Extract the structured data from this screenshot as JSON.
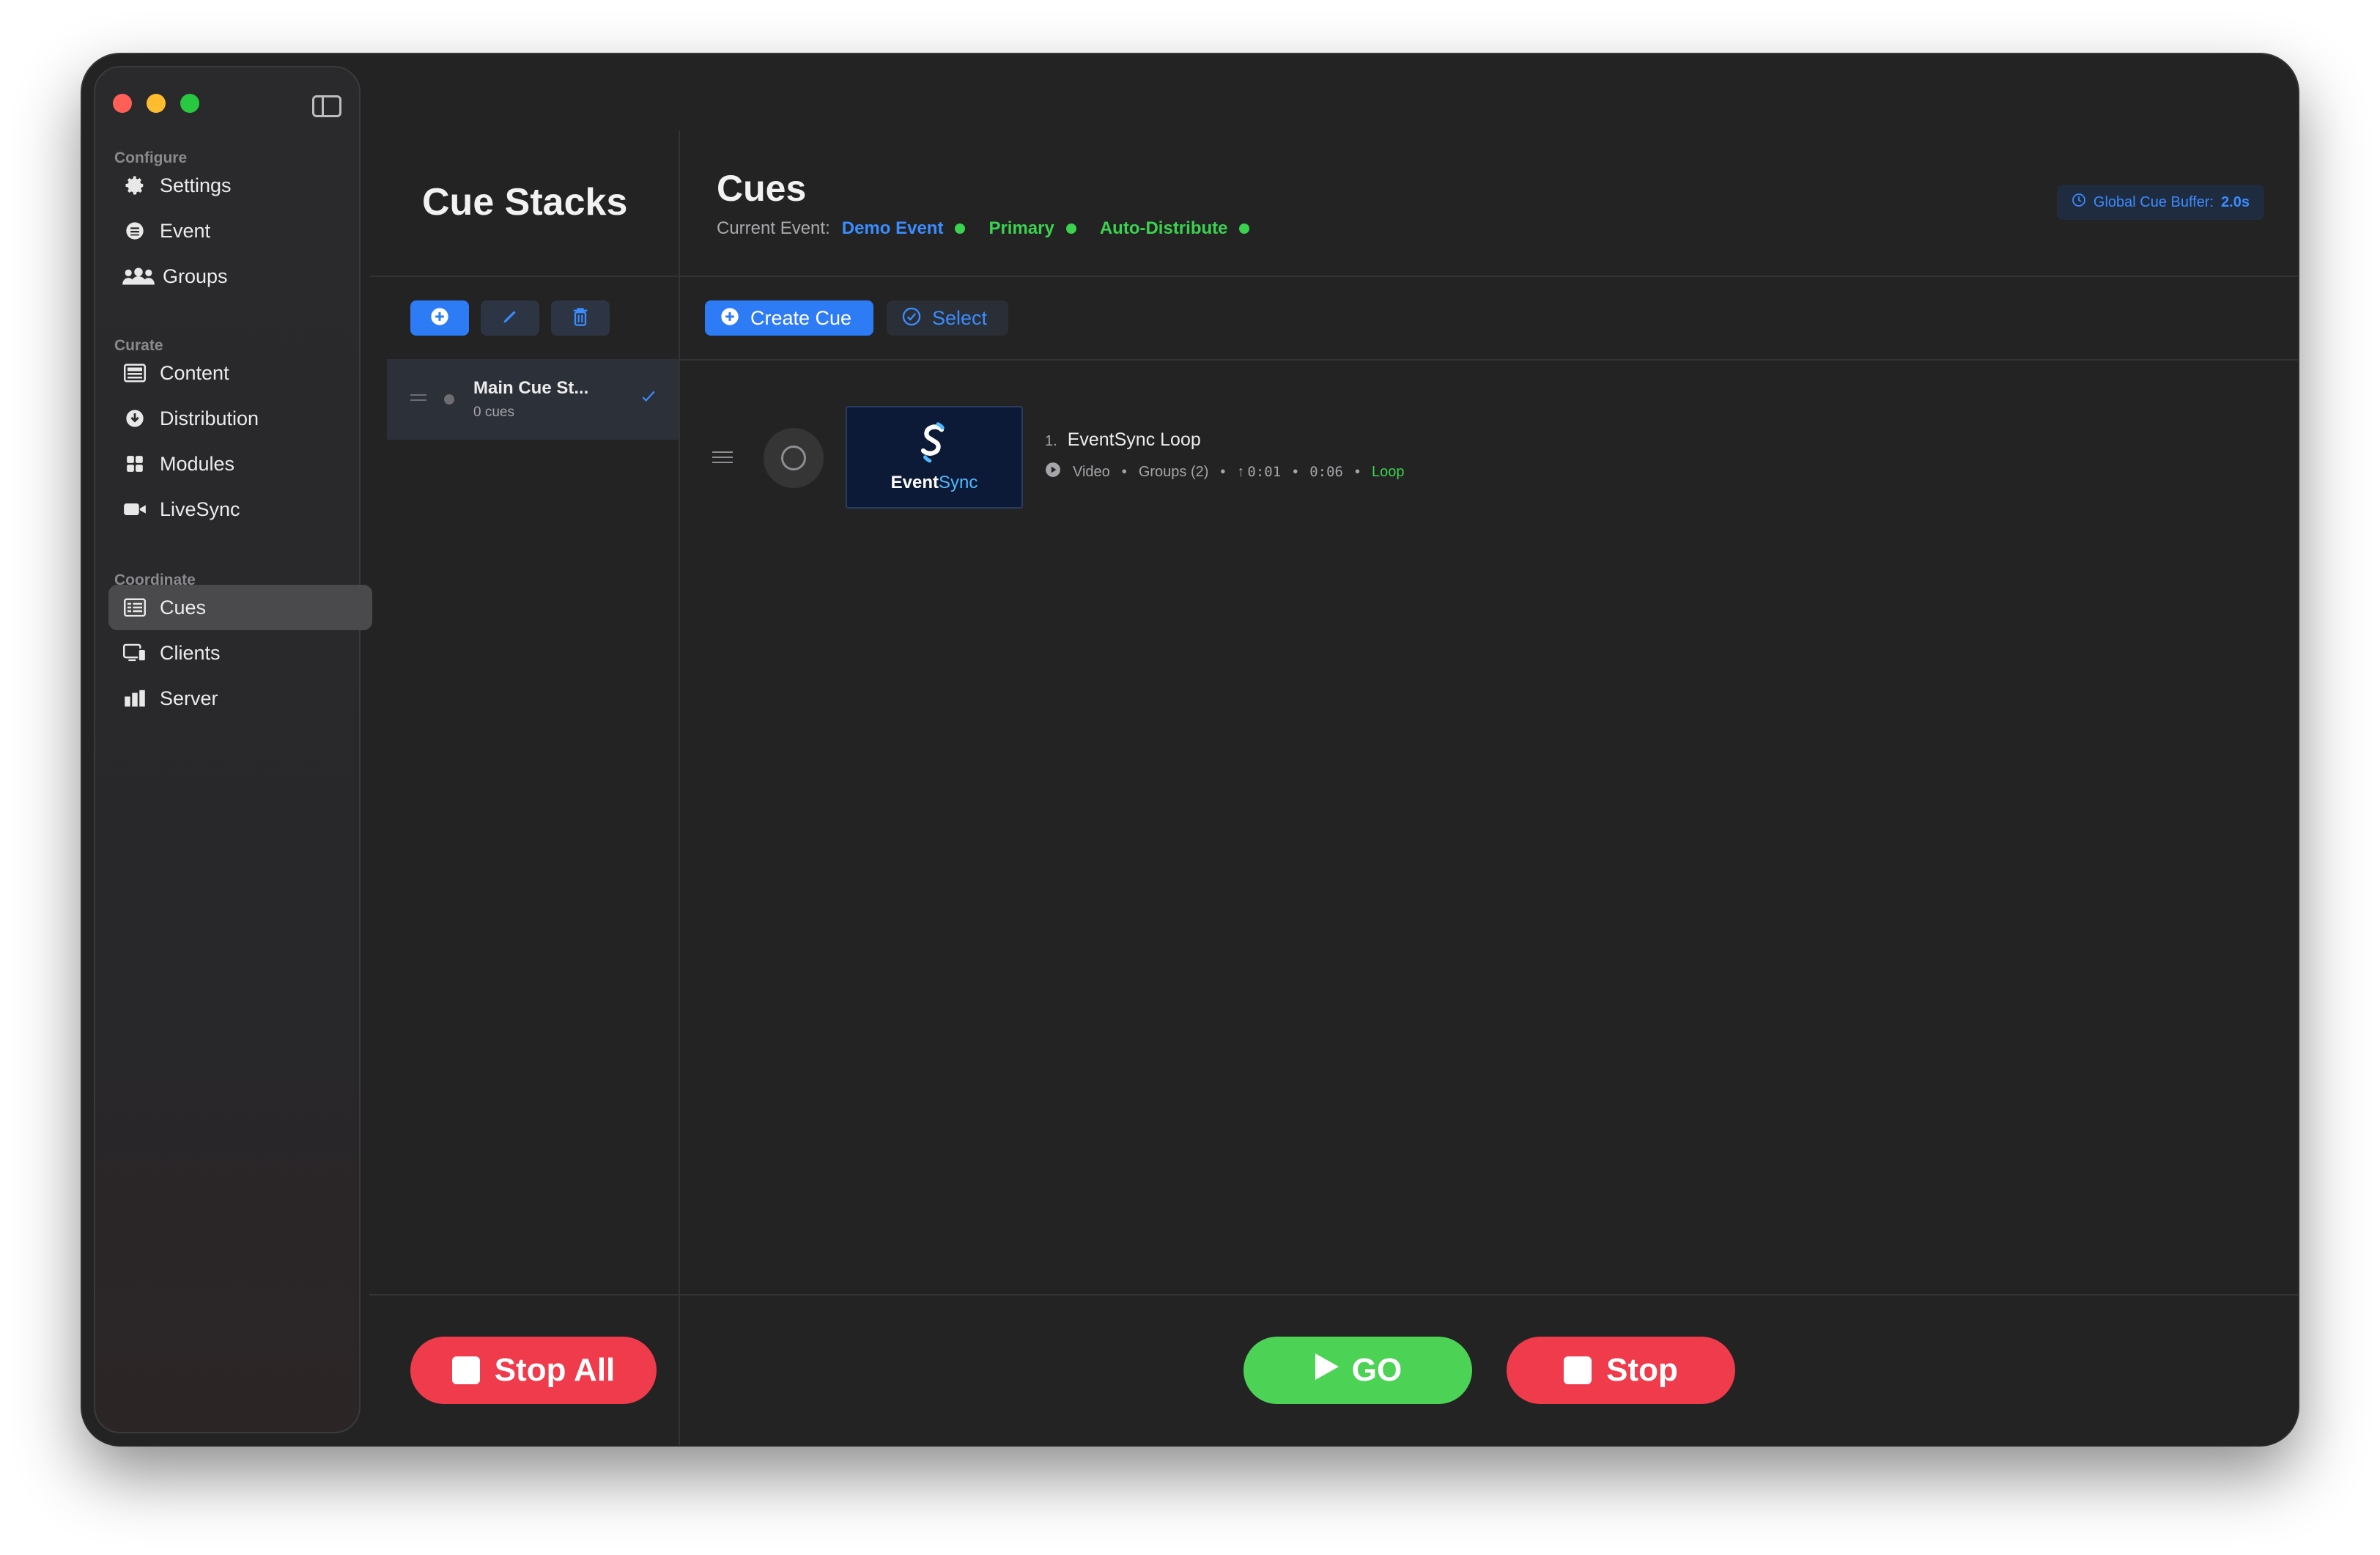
{
  "sidebar": {
    "sections": [
      {
        "title": "Configure",
        "items": [
          {
            "label": "Settings",
            "icon": "gear-icon"
          },
          {
            "label": "Event",
            "icon": "event-icon"
          },
          {
            "label": "Groups",
            "icon": "groups-icon"
          }
        ]
      },
      {
        "title": "Curate",
        "items": [
          {
            "label": "Content",
            "icon": "content-icon"
          },
          {
            "label": "Distribution",
            "icon": "distribution-icon"
          },
          {
            "label": "Modules",
            "icon": "modules-icon"
          },
          {
            "label": "LiveSync",
            "icon": "video-camera-icon"
          }
        ]
      },
      {
        "title": "Coordinate",
        "items": [
          {
            "label": "Cues",
            "icon": "cues-icon",
            "active": true
          },
          {
            "label": "Clients",
            "icon": "clients-icon"
          },
          {
            "label": "Server",
            "icon": "server-icon"
          }
        ]
      }
    ]
  },
  "stacks": {
    "title": "Cue Stacks",
    "items": [
      {
        "name": "Main Cue St...",
        "count": "0 cues",
        "selected": true
      }
    ],
    "stop_all_label": "Stop All"
  },
  "cues": {
    "title": "Cues",
    "current_event_label": "Current Event:",
    "current_event": "Demo Event",
    "mode": "Primary",
    "distribution": "Auto-Distribute",
    "buffer_label": "Global Cue Buffer:",
    "buffer_value": "2.0s",
    "create_label": "Create Cue",
    "select_label": "Select",
    "list": [
      {
        "number": "1.",
        "title": "EventSync Loop",
        "thumb_brand": "Event",
        "thumb_brand_accent": "Sync",
        "type": "Video",
        "groups": "Groups (2)",
        "start": "0:01",
        "duration": "0:06",
        "mode": "Loop"
      }
    ],
    "go_label": "GO",
    "stop_label": "Stop"
  },
  "colors": {
    "accent_blue": "#2e7bf6",
    "status_green": "#3bd24f",
    "stop_red": "#ef3b4b",
    "go_green": "#4cd356"
  }
}
